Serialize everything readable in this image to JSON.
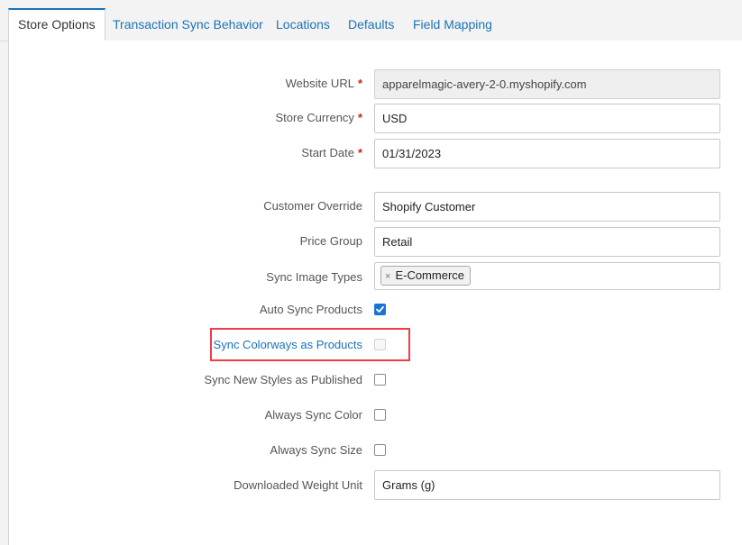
{
  "tabs": [
    {
      "label": "Store Options",
      "active": true
    },
    {
      "label": "Transaction Sync Behavior"
    },
    {
      "label": "Locations"
    },
    {
      "label": "Defaults"
    },
    {
      "label": "Field Mapping"
    }
  ],
  "form": {
    "website_url": {
      "label": "Website URL",
      "value": "apparelmagic-avery-2-0.myshopify.com"
    },
    "store_currency": {
      "label": "Store Currency",
      "value": "USD"
    },
    "start_date": {
      "label": "Start Date",
      "value": "01/31/2023"
    },
    "required_marker": "*",
    "customer_override": {
      "label": "Customer Override",
      "value": "Shopify Customer"
    },
    "price_group": {
      "label": "Price Group",
      "value": "Retail"
    },
    "sync_image_types": {
      "label": "Sync Image Types",
      "tag": "E-Commerce",
      "remove_glyph": "×"
    },
    "auto_sync_products": {
      "label": "Auto Sync Products",
      "checked": true
    },
    "sync_colorways": {
      "label": "Sync Colorways as Products",
      "checked": false,
      "disabled": true
    },
    "sync_new_styles": {
      "label": "Sync New Styles as Published",
      "checked": false
    },
    "always_sync_color": {
      "label": "Always Sync Color",
      "checked": false
    },
    "always_sync_size": {
      "label": "Always Sync Size",
      "checked": false
    },
    "downloaded_weight_unit": {
      "label": "Downloaded Weight Unit",
      "value": "Grams (g)"
    }
  },
  "colors": {
    "accent": "#1a73b8",
    "required": "#cc1f1f",
    "highlight": "#ee3d48",
    "checkbox_checked": "#1a73d9"
  }
}
